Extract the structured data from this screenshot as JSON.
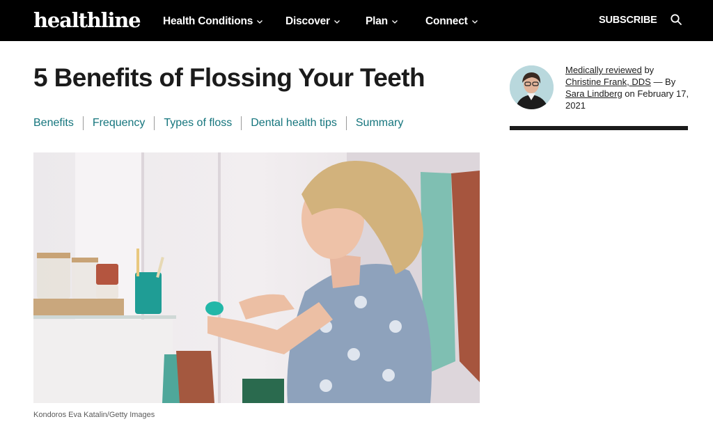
{
  "header": {
    "logo": "healthline",
    "nav": [
      {
        "label": "Health Conditions"
      },
      {
        "label": "Discover"
      },
      {
        "label": "Plan"
      },
      {
        "label": "Connect"
      }
    ],
    "subscribe_label": "SUBSCRIBE",
    "search_icon": "search-icon"
  },
  "article": {
    "title": "5 Benefits of Flossing Your Teeth",
    "toc": [
      "Benefits",
      "Frequency",
      "Types of floss",
      "Dental health tips",
      "Summary"
    ],
    "image_caption": "Kondoros Eva Katalin/Getty Images"
  },
  "sidebar": {
    "medically_reviewed": "Medically reviewed",
    "by": "by",
    "reviewer": "Christine Frank, DDS",
    "dash_by": "— By",
    "author": "Sara Lindberg",
    "date": "on February 17, 2021"
  },
  "colors": {
    "nav_bg": "#000000",
    "link_teal": "#15757d"
  }
}
